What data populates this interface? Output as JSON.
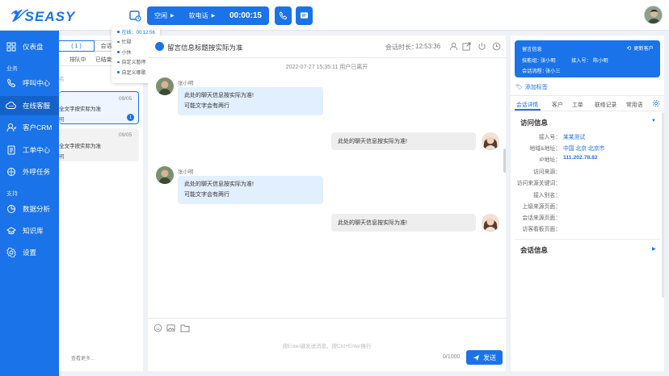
{
  "app": {
    "logo_text": "SEASY"
  },
  "call_bar": {
    "status": "空闲",
    "mode": "软电话",
    "timer": "00:00:15"
  },
  "status_menu": {
    "items": [
      "在线：00:12:56",
      "忙碌",
      "小休",
      "自定义暂停",
      "自定义哪歌"
    ]
  },
  "sidebar": {
    "dashboard": "仪表盘",
    "section_business": "业务",
    "section_support": "支持",
    "items": [
      "呼叫中心",
      "在线客服",
      "客户CRM",
      "工单中心",
      "外呼任务",
      "数据分析",
      "知识库",
      "设置"
    ]
  },
  "list_panel": {
    "tab_count": "( 1 )",
    "tab_other": "会话",
    "subtabs": [
      "排队中",
      "已结束"
    ],
    "search_hint": "名",
    "cards": [
      {
        "date": "09/05",
        "text": "全文字按实际为准",
        "sub": "明",
        "badge": "1"
      },
      {
        "date": "09/05",
        "text": "全文字按实际为准",
        "sub": "明"
      }
    ],
    "load_more": "查看更多..."
  },
  "chat": {
    "title": "留言信息标题按实际为准",
    "duration_label": "会话时长：",
    "duration": "12:53:36",
    "system_notice": "2022-07-27 15:35:11 用户已离开",
    "sender_name": "张小明",
    "in_line1": "此处的聊天信息按实际为准!",
    "in_line2": "可能文字会有两行",
    "out_text": "此处的聊天信息按实际为准!",
    "input_hint": "按Enter键发送消息，按Ctrl+Enter换行",
    "counter": "0/1000",
    "send_label": "发送"
  },
  "right_panel": {
    "card_title": "留言信息",
    "update_label": "更新客户",
    "dial_label": "技能组：",
    "dial_value": "张小明",
    "access_label": "接入号：",
    "access_value": "陈小明",
    "flow_label": "会话流程：",
    "flow_value": "张小三",
    "add_tag": "添加标签",
    "tabs": [
      "会话详情",
      "客户",
      "工单",
      "联络记录",
      "常用语"
    ],
    "visit_title": "访问信息",
    "session_title": "会话信息",
    "rows": [
      {
        "label": "接入号：",
        "value": "某某测试"
      },
      {
        "label": "地域&地址：",
        "value": "中国 北京 北京市"
      },
      {
        "label": "IP地址：",
        "value": "111.202.78.82"
      },
      {
        "label": "访问来源：",
        "value": ""
      },
      {
        "label": "访问来源关键词：",
        "value": ""
      },
      {
        "label": "接入别名：",
        "value": ""
      },
      {
        "label": "上级来源页面：",
        "value": ""
      },
      {
        "label": "会话来源页面：",
        "value": ""
      },
      {
        "label": "访客看板页面：",
        "value": ""
      }
    ]
  },
  "colors": {
    "accent": "#1a73e8",
    "bubble_in": "#e2efff",
    "bubble_out": "#eeeeee"
  }
}
